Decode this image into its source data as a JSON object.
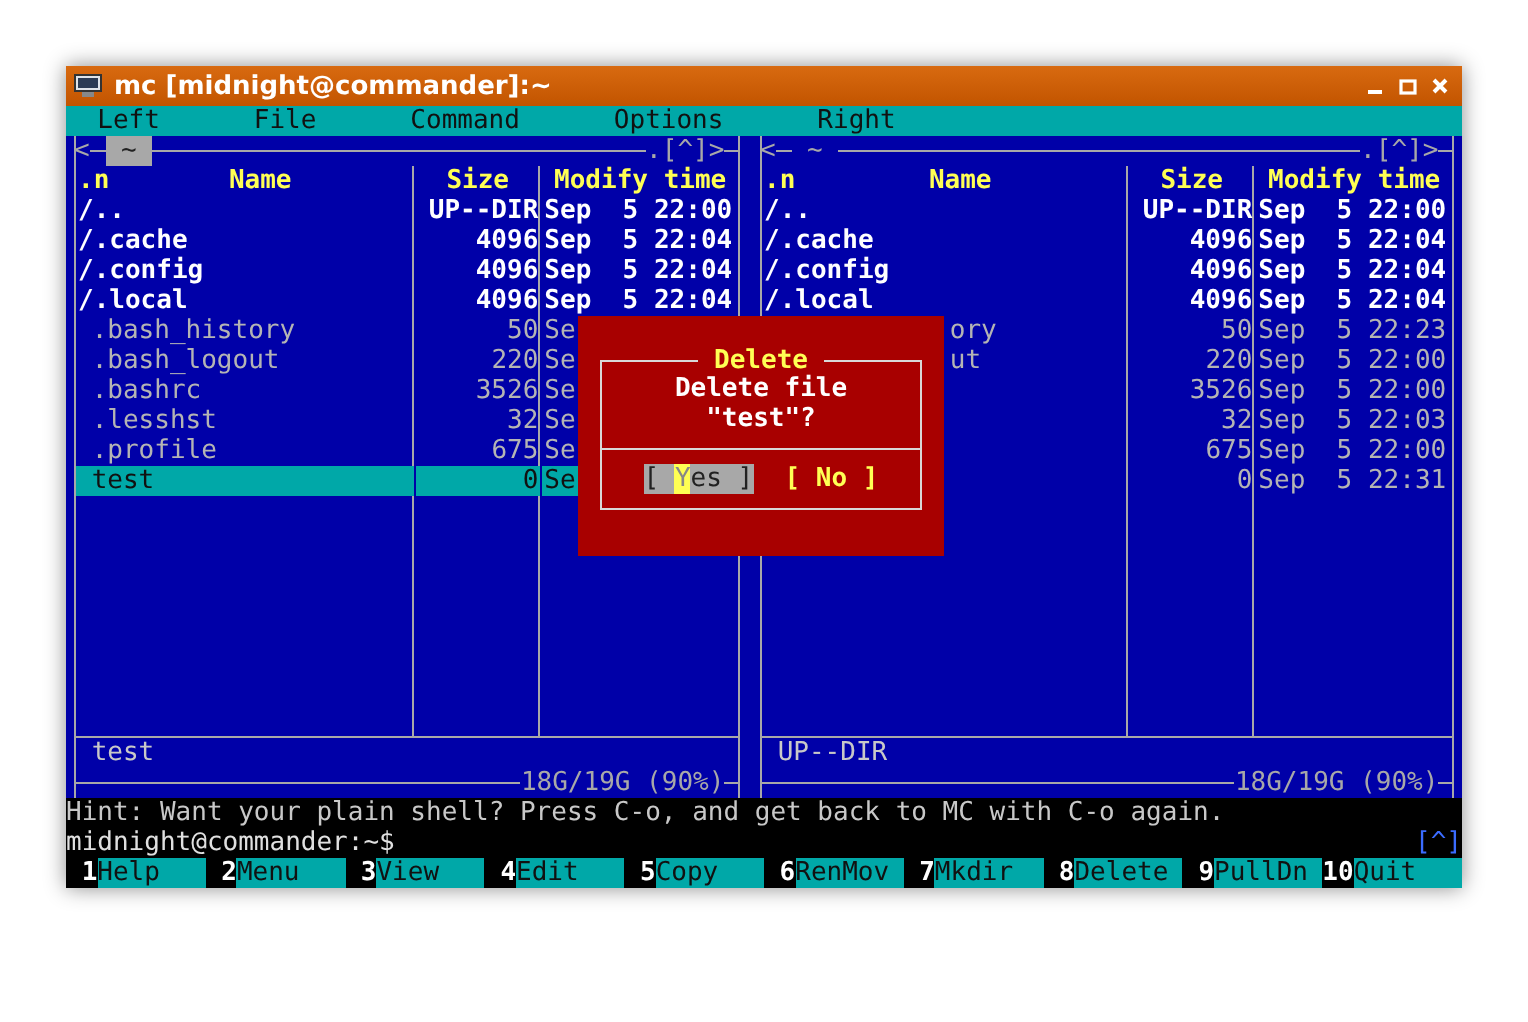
{
  "window": {
    "title": "mc [midnight@commander]:~"
  },
  "menu": [
    {
      "label": "Left"
    },
    {
      "label": "File"
    },
    {
      "label": "Command"
    },
    {
      "label": "Options"
    },
    {
      "label": "Right"
    }
  ],
  "panels": [
    {
      "active": true,
      "nav_left": "<",
      "path": "~",
      "nav_right": ".[^]>",
      "columns": [
        ".n",
        "Name",
        "Size",
        "Modify time"
      ],
      "rows": [
        {
          "kind": "dir",
          "name": "/..",
          "size": "UP--DIR",
          "date": "Sep  5 22:00",
          "selected": false
        },
        {
          "kind": "dir",
          "name": "/.cache",
          "size": "4096",
          "date": "Sep  5 22:04",
          "selected": false
        },
        {
          "kind": "dir",
          "name": "/.config",
          "size": "4096",
          "date": "Sep  5 22:04",
          "selected": false
        },
        {
          "kind": "dir",
          "name": "/.local",
          "size": "4096",
          "date": "Sep  5 22:04",
          "selected": false
        },
        {
          "kind": "file",
          "name": ".bash_history",
          "size": "50",
          "date": "Se",
          "selected": false
        },
        {
          "kind": "file",
          "name": ".bash_logout",
          "size": "220",
          "date": "Se",
          "selected": false
        },
        {
          "kind": "file",
          "name": ".bashrc",
          "size": "3526",
          "date": "Se",
          "selected": false
        },
        {
          "kind": "file",
          "name": ".lesshst",
          "size": "32",
          "date": "Se",
          "selected": false
        },
        {
          "kind": "file",
          "name": ".profile",
          "size": "675",
          "date": "Se",
          "selected": false
        },
        {
          "kind": "file",
          "name": "test",
          "size": "0",
          "date": "Se",
          "selected": true
        }
      ],
      "mini_status": "test",
      "disk": "18G/19G (90%)"
    },
    {
      "active": false,
      "nav_left": "<",
      "path": "~",
      "nav_right": ".[^]>",
      "columns": [
        ".n",
        "Name",
        "Size",
        "Modify time"
      ],
      "rows": [
        {
          "kind": "dir",
          "name": "/..",
          "size": "UP--DIR",
          "date": "Sep  5 22:00",
          "selected": false
        },
        {
          "kind": "dir",
          "name": "/.cache",
          "size": "4096",
          "date": "Sep  5 22:04",
          "selected": false
        },
        {
          "kind": "dir",
          "name": "/.config",
          "size": "4096",
          "date": "Sep  5 22:04",
          "selected": false
        },
        {
          "kind": "dir",
          "name": "/.local",
          "size": "4096",
          "date": "Sep  5 22:04",
          "selected": false
        },
        {
          "kind": "file",
          "name": "ory",
          "covered": true,
          "size": "50",
          "date": "Sep  5 22:23",
          "selected": false
        },
        {
          "kind": "file",
          "name": "ut",
          "covered": true,
          "size": "220",
          "date": "Sep  5 22:00",
          "selected": false
        },
        {
          "kind": "file",
          "size": "3526",
          "date": "Sep  5 22:00",
          "selected": false
        },
        {
          "kind": "file",
          "size": "32",
          "date": "Sep  5 22:03",
          "selected": false
        },
        {
          "kind": "file",
          "size": "675",
          "date": "Sep  5 22:00",
          "selected": false
        },
        {
          "kind": "file",
          "size": "0",
          "date": "Sep  5 22:31",
          "selected": false
        }
      ],
      "mini_status": "UP--DIR",
      "disk": "18G/19G (90%)"
    }
  ],
  "dialog": {
    "title": "Delete",
    "message": [
      "Delete file",
      "\"test\"?"
    ],
    "buttons": [
      {
        "before": "[ ",
        "hotkey": "Y",
        "after": "es ]",
        "selected": true
      },
      {
        "before": "[ ",
        "hotkey": "N",
        "after": "o ]",
        "selected": false
      }
    ]
  },
  "hint": "Hint: Want your plain shell? Press C-o, and get back to MC with C-o again.",
  "prompt": "midnight@commander:~$",
  "scroll_marker": "[^]",
  "fkeys": [
    {
      "key": "1",
      "label": "Help"
    },
    {
      "key": "2",
      "label": "Menu"
    },
    {
      "key": "3",
      "label": "View"
    },
    {
      "key": "4",
      "label": "Edit"
    },
    {
      "key": "5",
      "label": "Copy"
    },
    {
      "key": "6",
      "label": "RenMov"
    },
    {
      "key": "7",
      "label": "Mkdir"
    },
    {
      "key": "8",
      "label": "Delete"
    },
    {
      "key": "9",
      "label": "PullDn"
    },
    {
      "key": "10",
      "label": "Quit"
    }
  ]
}
